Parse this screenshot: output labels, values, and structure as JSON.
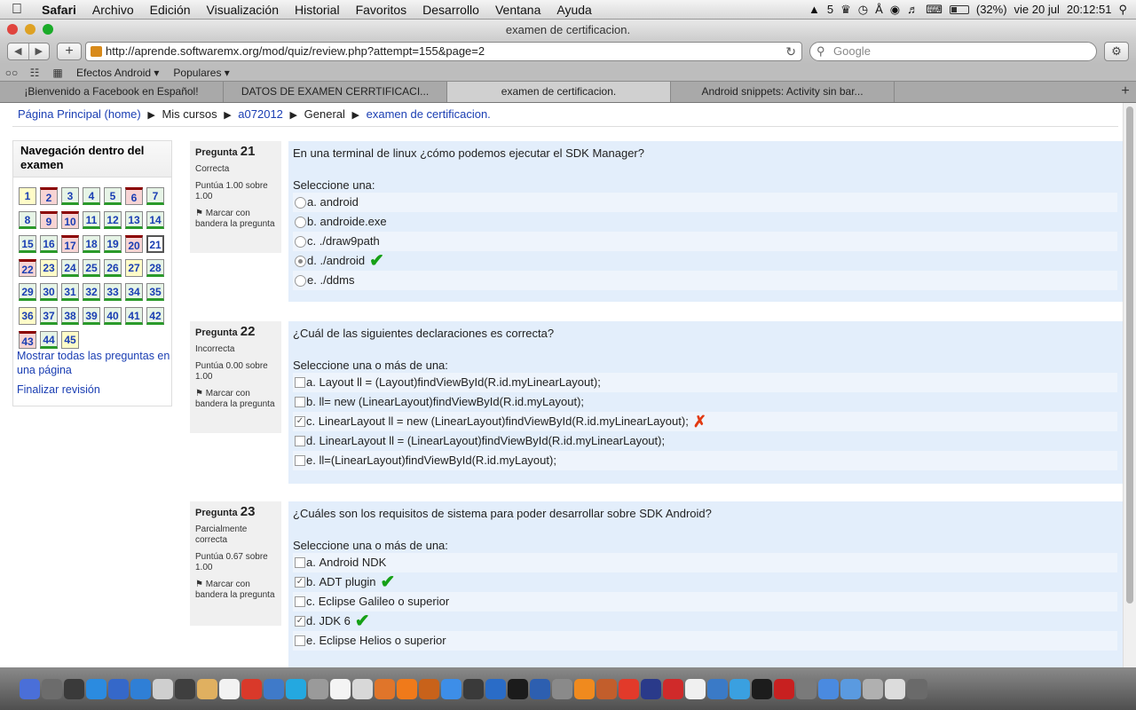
{
  "menubar": {
    "app": "Safari",
    "items": [
      "Archivo",
      "Edición",
      "Visualización",
      "Historial",
      "Favoritos",
      "Desarrollo",
      "Ventana",
      "Ayuda"
    ],
    "status": {
      "adobe": "5",
      "battery": "(32%)",
      "date": "vie 20 jul",
      "time": "20:12:51"
    }
  },
  "window": {
    "title": "examen de certificacion."
  },
  "toolbar": {
    "url": "http://aprende.softwaremx.org/mod/quiz/review.php?attempt=155&page=2",
    "search_placeholder": "Google"
  },
  "bookmarks": [
    "Efectos Android ▾",
    "Populares ▾"
  ],
  "tabs": [
    {
      "label": "¡Bienvenido a Facebook en Español!",
      "active": false
    },
    {
      "label": "DATOS DE EXAMEN CERRTIFICACI...",
      "active": false
    },
    {
      "label": "examen de certificacion.",
      "active": true
    },
    {
      "label": "Android snippets: Activity sin bar...",
      "active": false
    }
  ],
  "breadcrumb": {
    "home": "Página Principal (home)",
    "mis_cursos": "Mis cursos",
    "course": "a072012",
    "section": "General",
    "current": "examen de certificacion."
  },
  "nav": {
    "title": "Navegación dentro del examen",
    "rows": [
      [
        {
          "n": "1",
          "s": "part"
        },
        {
          "n": "2",
          "s": "bad"
        },
        {
          "n": "3",
          "s": "ok"
        },
        {
          "n": "4",
          "s": "ok"
        },
        {
          "n": "5",
          "s": "ok"
        },
        {
          "n": "6",
          "s": "bad"
        },
        {
          "n": "7",
          "s": "ok"
        }
      ],
      [
        {
          "n": "8",
          "s": "ok"
        },
        {
          "n": "9",
          "s": "bad"
        },
        {
          "n": "10",
          "s": "bad"
        },
        {
          "n": "11",
          "s": "ok"
        },
        {
          "n": "12",
          "s": "ok"
        },
        {
          "n": "13",
          "s": "ok"
        },
        {
          "n": "14",
          "s": "ok"
        }
      ],
      [
        {
          "n": "15",
          "s": "ok"
        },
        {
          "n": "16",
          "s": "ok"
        },
        {
          "n": "17",
          "s": "bad"
        },
        {
          "n": "18",
          "s": "ok"
        },
        {
          "n": "19",
          "s": "ok"
        },
        {
          "n": "20",
          "s": "bad"
        },
        {
          "n": "21",
          "s": "cur"
        }
      ],
      [
        {
          "n": "22",
          "s": "bad"
        },
        {
          "n": "23",
          "s": "part"
        },
        {
          "n": "24",
          "s": "ok"
        },
        {
          "n": "25",
          "s": "ok"
        },
        {
          "n": "26",
          "s": "ok"
        },
        {
          "n": "27",
          "s": "part"
        },
        {
          "n": "28",
          "s": "ok"
        }
      ],
      [
        {
          "n": "29",
          "s": "ok"
        },
        {
          "n": "30",
          "s": "ok"
        },
        {
          "n": "31",
          "s": "ok"
        },
        {
          "n": "32",
          "s": "ok"
        },
        {
          "n": "33",
          "s": "ok"
        },
        {
          "n": "34",
          "s": "ok"
        },
        {
          "n": "35",
          "s": "ok"
        }
      ],
      [
        {
          "n": "36",
          "s": "part"
        },
        {
          "n": "37",
          "s": "ok"
        },
        {
          "n": "38",
          "s": "ok"
        },
        {
          "n": "39",
          "s": "ok"
        },
        {
          "n": "40",
          "s": "ok"
        },
        {
          "n": "41",
          "s": "ok"
        },
        {
          "n": "42",
          "s": "ok"
        }
      ],
      [
        {
          "n": "43",
          "s": "bad"
        },
        {
          "n": "44",
          "s": "ok"
        },
        {
          "n": "45",
          "s": "part"
        }
      ]
    ],
    "show_all": "Mostrar todas las preguntas en una página",
    "finish": "Finalizar revisión"
  },
  "questions": [
    {
      "label": "Pregunta",
      "number": "21",
      "state": "Correcta",
      "grade": "Puntúa 1.00 sobre 1.00",
      "flag": "Marcar con bandera la pregunta",
      "text": "En una terminal de linux ¿cómo podemos ejecutar el SDK Manager?",
      "prompt": "Seleccione una:",
      "type": "radio",
      "answers": [
        {
          "letter": "a.",
          "text": "android",
          "selected": false,
          "mark": ""
        },
        {
          "letter": "b.",
          "text": "androide.exe",
          "selected": false,
          "mark": ""
        },
        {
          "letter": "c.",
          "text": "./draw9path",
          "selected": false,
          "mark": ""
        },
        {
          "letter": "d.",
          "text": "./android",
          "selected": true,
          "mark": "correct"
        },
        {
          "letter": "e.",
          "text": "./ddms",
          "selected": false,
          "mark": ""
        }
      ]
    },
    {
      "label": "Pregunta",
      "number": "22",
      "state": "Incorrecta",
      "grade": "Puntúa 0.00 sobre 1.00",
      "flag": "Marcar con bandera la pregunta",
      "text": "¿Cuál de las siguientes declaraciones es correcta?",
      "prompt": "Seleccione una o más de una:",
      "type": "checkbox",
      "answers": [
        {
          "letter": "a.",
          "text": "Layout ll = (Layout)findViewById(R.id.myLinearLayout);",
          "selected": false,
          "mark": ""
        },
        {
          "letter": "b.",
          "text": "ll= new (LinearLayout)findViewById(R.id.myLayout);",
          "selected": false,
          "mark": ""
        },
        {
          "letter": "c.",
          "text": "LinearLayout ll = new (LinearLayout)findViewById(R.id.myLinearLayout);",
          "selected": true,
          "mark": "incorrect"
        },
        {
          "letter": "d.",
          "text": "LinearLayout ll = (LinearLayout)findViewById(R.id.myLinearLayout);",
          "selected": false,
          "mark": ""
        },
        {
          "letter": "e.",
          "text": "ll=(LinearLayout)findViewById(R.id.myLayout);",
          "selected": false,
          "mark": ""
        }
      ]
    },
    {
      "label": "Pregunta",
      "number": "23",
      "state": "Parcialmente correcta",
      "grade": "Puntúa 0.67 sobre 1.00",
      "flag": "Marcar con bandera la pregunta",
      "text": "¿Cuáles son los requisitos de sistema para poder desarrollar sobre SDK Android?",
      "prompt": "Seleccione una o más de una:",
      "type": "checkbox",
      "answers": [
        {
          "letter": "a.",
          "text": "Android NDK",
          "selected": false,
          "mark": ""
        },
        {
          "letter": "b.",
          "text": "ADT plugin",
          "selected": true,
          "mark": "correct"
        },
        {
          "letter": "c.",
          "text": "Eclipse Galileo o superior",
          "selected": false,
          "mark": ""
        },
        {
          "letter": "d.",
          "text": "JDK 6",
          "selected": true,
          "mark": "correct"
        },
        {
          "letter": "e.",
          "text": "Eclipse Helios o superior",
          "selected": false,
          "mark": ""
        }
      ]
    }
  ],
  "dock_colors": [
    "#4a6fd8",
    "#6c6c6c",
    "#3a3a3a",
    "#2b8be0",
    "#3568c9",
    "#2f7fd6",
    "#cfcfcf",
    "#3f3f3f",
    "#e0b060",
    "#f2f2f2",
    "#d9392a",
    "#3f7ac9",
    "#24a8e0",
    "#9a9a9a",
    "#f4f4f4",
    "#d8d8d8",
    "#e0752a",
    "#f07a1a",
    "#c8621a",
    "#3d8ee8",
    "#3a3a3a",
    "#2a6cc7",
    "#1b1b1b",
    "#2d5fb0",
    "#8a8a8a",
    "#f08a1e",
    "#c25e2c",
    "#e23a2a",
    "#2a3a8a",
    "#d02a2a",
    "#f0f0f0",
    "#3a7ac7",
    "#3aa0e0",
    "#1c1c1c",
    "#c82020",
    "#7a7a7a",
    "#4a8ae0",
    "#5a9ae0",
    "#b0b0b0",
    "#dcdcdc",
    "#6a6a6a"
  ]
}
